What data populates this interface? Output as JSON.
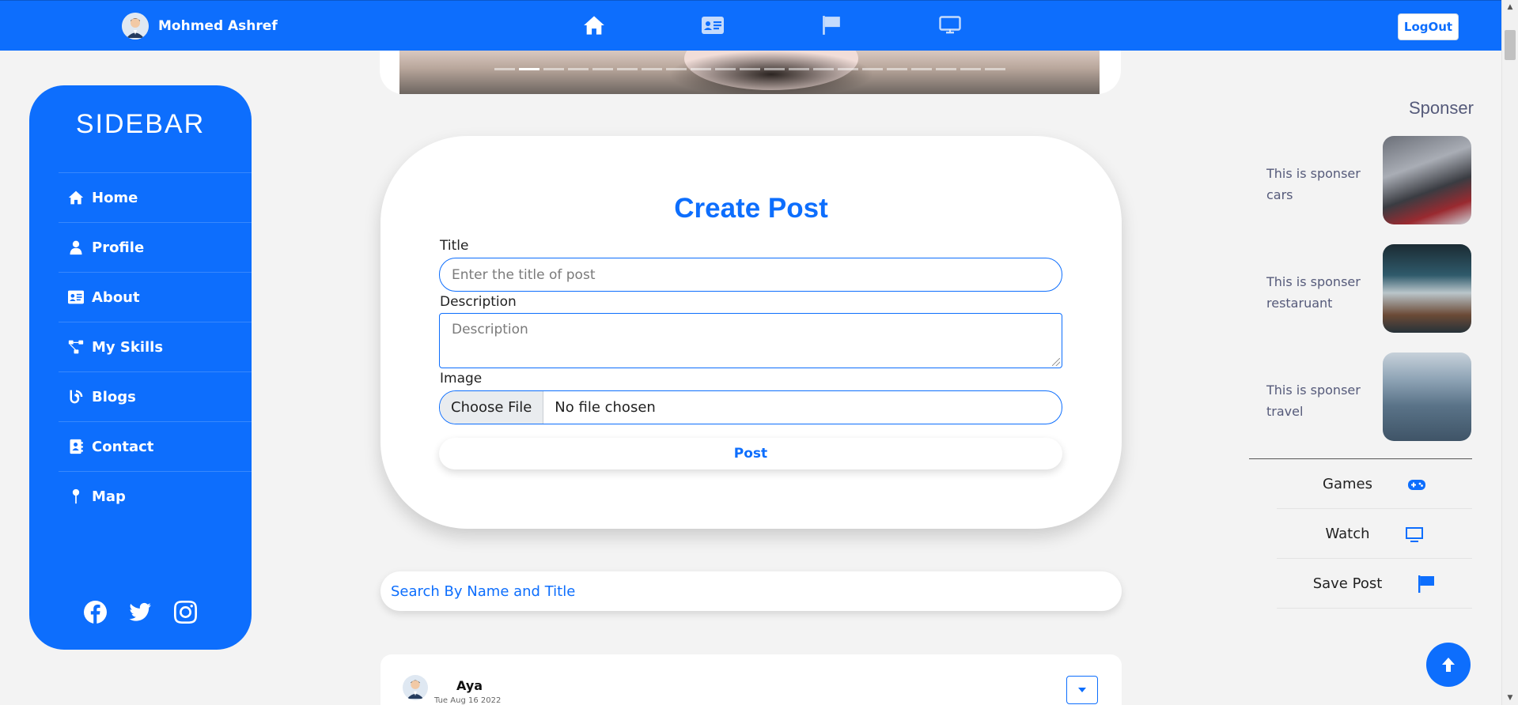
{
  "navbar": {
    "user_name": "Mohmed Ashref",
    "icons": [
      "home-icon",
      "id-card-icon",
      "flag-icon",
      "desktop-icon"
    ],
    "logout_label": "LogOut"
  },
  "sidebar": {
    "title": "SIDEBAR",
    "items": [
      {
        "label": "Home",
        "icon": "home-icon"
      },
      {
        "label": "Profile",
        "icon": "user-icon"
      },
      {
        "label": "About",
        "icon": "id-card-icon"
      },
      {
        "label": "My Skills",
        "icon": "network-icon"
      },
      {
        "label": "Blogs",
        "icon": "blog-icon"
      },
      {
        "label": "Contact",
        "icon": "address-book-icon"
      },
      {
        "label": "Map",
        "icon": "map-pin-icon"
      }
    ],
    "socials": [
      "facebook-icon",
      "twitter-icon",
      "instagram-icon"
    ]
  },
  "create_post": {
    "title": "Create Post",
    "title_label": "Title",
    "title_placeholder": "Enter the title of post",
    "description_label": "Description",
    "description_placeholder": "Description",
    "image_label": "Image",
    "choose_file_label": "Choose File",
    "no_file_text": "No file chosen",
    "post_button": "Post"
  },
  "search": {
    "placeholder": "Search By Name and Title"
  },
  "post": {
    "user": "Aya",
    "date": "Tue Aug 16 2022"
  },
  "sponsor": {
    "title": "Sponser",
    "items": [
      {
        "text": "This is sponser cars"
      },
      {
        "text": "This is sponser restaruant"
      },
      {
        "text": "This is sponser travel"
      }
    ]
  },
  "utilities": [
    {
      "label": "Games",
      "icon": "gamepad-icon"
    },
    {
      "label": "Watch",
      "icon": "tv-icon"
    },
    {
      "label": "Save Post",
      "icon": "flag-icon"
    }
  ],
  "colors": {
    "primary": "#0d6efd",
    "background": "#f3f3f3",
    "muted_text": "#555a7a"
  }
}
